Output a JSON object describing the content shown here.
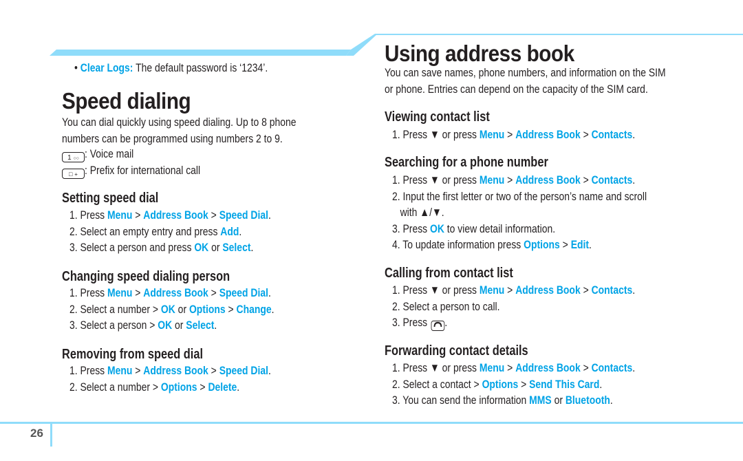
{
  "colors": {
    "accent_text": "#00a3e6",
    "band": "#8fdcfa",
    "body_text": "#231f20",
    "page_number": "#555555"
  },
  "left": {
    "bullet": {
      "label": "Clear Logs:",
      "text": " The default password is ‘1234’."
    },
    "title": "Speed dialing",
    "intro": [
      "You can dial quickly using speed dialing. Up to 8 phone",
      "numbers can be programmed using numbers 2 to 9."
    ],
    "keys": [
      {
        "key_label": "1",
        "key_icon": "voicemail-icon",
        "text": " : Voice mail"
      },
      {
        "key_label": "0",
        "key_icon": "plus-icon",
        "text": " : Prefix for international call"
      }
    ],
    "sections": [
      {
        "heading": "Setting speed dial",
        "steps": [
          {
            "parts": [
              {
                "t": "1. Press "
              },
              {
                "t": "Menu",
                "hl": true
              },
              {
                "t": " > "
              },
              {
                "t": "Address Book",
                "hl": true
              },
              {
                "t": " > "
              },
              {
                "t": "Speed Dial",
                "hl": true
              },
              {
                "t": "."
              }
            ]
          },
          {
            "parts": [
              {
                "t": "2. Select an empty entry and press "
              },
              {
                "t": "Add",
                "hl": true
              },
              {
                "t": "."
              }
            ]
          },
          {
            "parts": [
              {
                "t": "3. Select a person and press "
              },
              {
                "t": "OK",
                "hl": true
              },
              {
                "t": " or "
              },
              {
                "t": "Select",
                "hl": true
              },
              {
                "t": "."
              }
            ]
          }
        ]
      },
      {
        "heading": "Changing speed dialing person",
        "steps": [
          {
            "parts": [
              {
                "t": "1. Press "
              },
              {
                "t": "Menu",
                "hl": true
              },
              {
                "t": " > "
              },
              {
                "t": "Address Book",
                "hl": true
              },
              {
                "t": " > "
              },
              {
                "t": "Speed Dial",
                "hl": true
              },
              {
                "t": "."
              }
            ]
          },
          {
            "parts": [
              {
                "t": "2. Select a number > "
              },
              {
                "t": "OK",
                "hl": true
              },
              {
                "t": " or "
              },
              {
                "t": "Options",
                "hl": true
              },
              {
                "t": " > "
              },
              {
                "t": "Change",
                "hl": true
              },
              {
                "t": "."
              }
            ]
          },
          {
            "parts": [
              {
                "t": "3. Select a person > "
              },
              {
                "t": "OK",
                "hl": true
              },
              {
                "t": " or "
              },
              {
                "t": "Select",
                "hl": true
              },
              {
                "t": "."
              }
            ]
          }
        ]
      },
      {
        "heading": "Removing from speed dial",
        "steps": [
          {
            "parts": [
              {
                "t": "1. Press "
              },
              {
                "t": "Menu",
                "hl": true
              },
              {
                "t": " > "
              },
              {
                "t": "Address Book",
                "hl": true
              },
              {
                "t": " > "
              },
              {
                "t": "Speed Dial",
                "hl": true
              },
              {
                "t": "."
              }
            ]
          },
          {
            "parts": [
              {
                "t": "2. Select a number > "
              },
              {
                "t": "Options",
                "hl": true
              },
              {
                "t": " > "
              },
              {
                "t": "Delete",
                "hl": true
              },
              {
                "t": "."
              }
            ]
          }
        ]
      }
    ]
  },
  "right": {
    "title": "Using address book",
    "intro": [
      "You can save names, phone numbers, and information on the SIM",
      "or phone. Entries can depend on the capacity of the SIM card."
    ],
    "sections": [
      {
        "heading": "Viewing contact list",
        "steps": [
          {
            "parts": [
              {
                "t": "1. Press ▼ or press "
              },
              {
                "t": "Menu",
                "hl": true
              },
              {
                "t": " > "
              },
              {
                "t": "Address Book",
                "hl": true
              },
              {
                "t": " > "
              },
              {
                "t": "Contacts",
                "hl": true
              },
              {
                "t": "."
              }
            ]
          }
        ]
      },
      {
        "heading": "Searching for a phone number",
        "steps": [
          {
            "parts": [
              {
                "t": "1. Press ▼ or press "
              },
              {
                "t": "Menu",
                "hl": true
              },
              {
                "t": " > "
              },
              {
                "t": "Address Book",
                "hl": true
              },
              {
                "t": " > "
              },
              {
                "t": "Contacts",
                "hl": true
              },
              {
                "t": "."
              }
            ]
          },
          {
            "parts": [
              {
                "t": "2. Input the first letter or two of the person’s name and scroll"
              }
            ]
          },
          {
            "parts": [
              {
                "t": "   with ▲/▼."
              }
            ]
          },
          {
            "parts": [
              {
                "t": "3. Press "
              },
              {
                "t": "OK",
                "hl": true
              },
              {
                "t": " to view detail information."
              }
            ]
          },
          {
            "parts": [
              {
                "t": "4. To update information press "
              },
              {
                "t": "Options",
                "hl": true
              },
              {
                "t": " > "
              },
              {
                "t": "Edit",
                "hl": true
              },
              {
                "t": "."
              }
            ]
          }
        ]
      },
      {
        "heading": "Calling from contact list",
        "steps": [
          {
            "parts": [
              {
                "t": "1. Press ▼ or press "
              },
              {
                "t": "Menu",
                "hl": true
              },
              {
                "t": " > "
              },
              {
                "t": "Address Book",
                "hl": true
              },
              {
                "t": " > "
              },
              {
                "t": "Contacts",
                "hl": true
              },
              {
                "t": "."
              }
            ]
          },
          {
            "parts": [
              {
                "t": "2. Select a person to call."
              }
            ]
          },
          {
            "parts": [
              {
                "t": "3. Press "
              },
              {
                "icon": "send-key-icon"
              },
              {
                "t": "."
              }
            ]
          }
        ]
      },
      {
        "heading": "Forwarding contact details",
        "steps": [
          {
            "parts": [
              {
                "t": "1. Press ▼ or press "
              },
              {
                "t": "Menu",
                "hl": true
              },
              {
                "t": " > "
              },
              {
                "t": "Address Book",
                "hl": true
              },
              {
                "t": " > "
              },
              {
                "t": "Contacts",
                "hl": true
              },
              {
                "t": "."
              }
            ]
          },
          {
            "parts": [
              {
                "t": "2. Select a contact > "
              },
              {
                "t": "Options",
                "hl": true
              },
              {
                "t": " > "
              },
              {
                "t": "Send This Card",
                "hl": true
              },
              {
                "t": "."
              }
            ]
          },
          {
            "parts": [
              {
                "t": "3. You can send the information "
              },
              {
                "t": "MMS",
                "hl": true
              },
              {
                "t": " or "
              },
              {
                "t": "Bluetooth",
                "hl": true
              },
              {
                "t": "."
              }
            ]
          }
        ]
      }
    ]
  },
  "footer": {
    "page_number": "26"
  }
}
